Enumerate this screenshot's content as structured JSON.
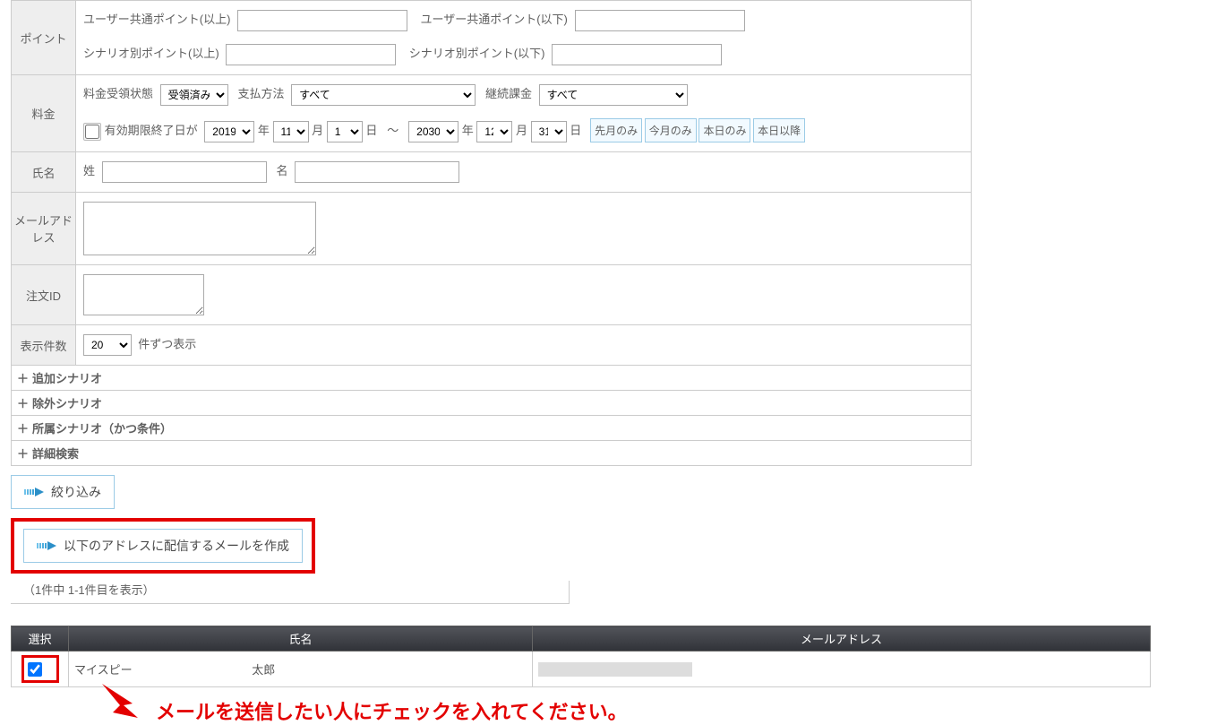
{
  "form": {
    "rows": {
      "points": {
        "label": "ポイント",
        "user_min_label": "ユーザー共通ポイント(以上)",
        "user_max_label": "ユーザー共通ポイント(以下)",
        "scenario_min_label": "シナリオ別ポイント(以上)",
        "scenario_max_label": "シナリオ別ポイント(以下)"
      },
      "fee": {
        "label": "料金",
        "receipt_status_label": "料金受領状態",
        "receipt_status_value": "受領済み",
        "pay_method_label": "支払方法",
        "pay_method_value": "すべて",
        "subscription_label": "継続課金",
        "subscription_value": "すべて",
        "expiry_label": "有効期限終了日が",
        "year_from": "2019",
        "mon_from": "11",
        "day_from": "1",
        "range_sep": "～",
        "year_to": "2030",
        "mon_to": "12",
        "day_to": "31",
        "unit_year": "年",
        "unit_month": "月",
        "unit_day": "日",
        "btns": {
          "last_month": "先月のみ",
          "this_month": "今月のみ",
          "today": "本日のみ",
          "after_today": "本日以降"
        }
      },
      "name": {
        "label": "氏名",
        "last_label": "姓",
        "first_label": "名"
      },
      "email": {
        "label": "メールアドレス"
      },
      "order": {
        "label": "注文ID"
      },
      "display": {
        "label": "表示件数",
        "value": "20",
        "suffix": "件ずつ表示"
      }
    },
    "collapse": {
      "plus": "＋",
      "add_scenario": "追加シナリオ",
      "exclude_scenario": "除外シナリオ",
      "belong_scenario": "所属シナリオ（かつ条件）",
      "advanced": "詳細検索"
    }
  },
  "actions": {
    "narrow": "絞り込み",
    "create_mail": "以下のアドレスに配信するメールを作成"
  },
  "results": {
    "count_text": "（1件中 1-1件目を表示）",
    "headers": {
      "select": "選択",
      "name": "氏名",
      "email": "メールアドレス"
    },
    "rows": [
      {
        "checked": true,
        "ln": "マイスピー",
        "fn": "太郎"
      }
    ]
  },
  "callout": {
    "text": "メールを送信したい人にチェックを入れてください。"
  }
}
